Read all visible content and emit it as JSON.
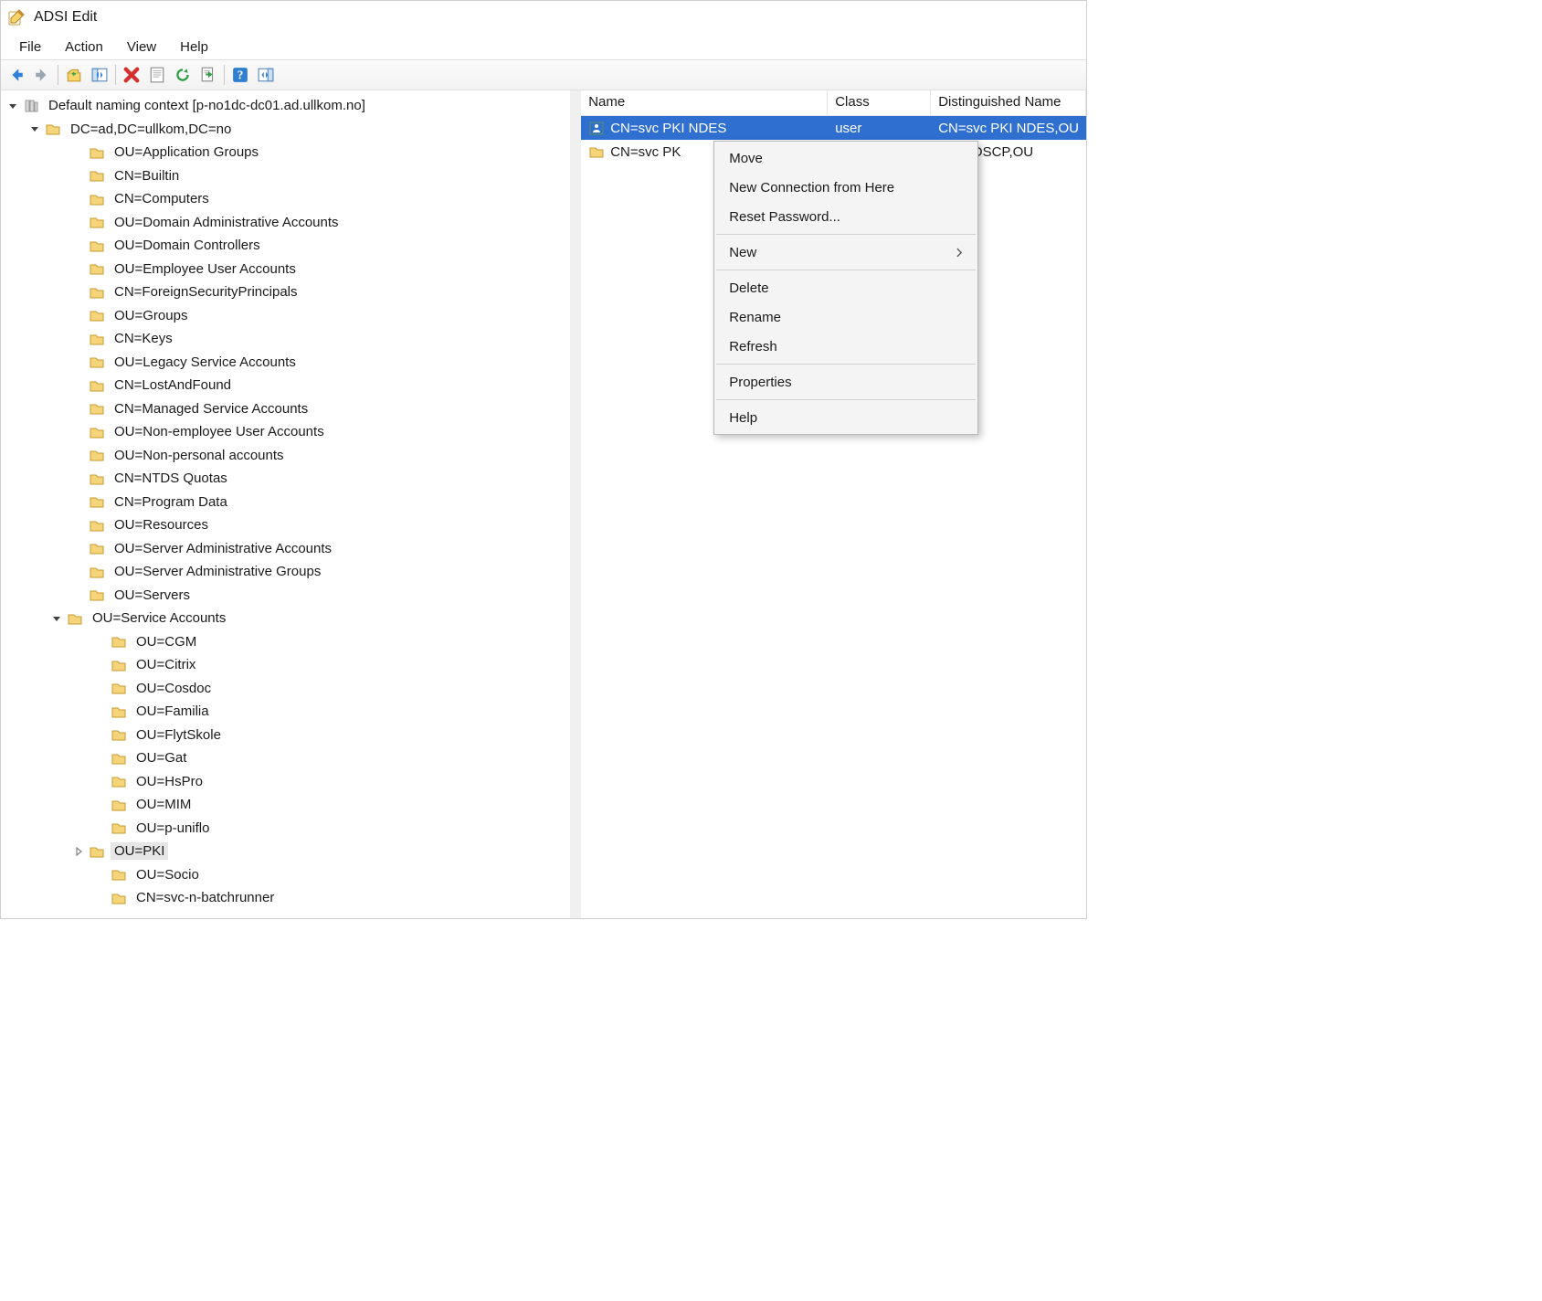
{
  "window_title": "ADSI Edit",
  "menus": {
    "file": "File",
    "action": "Action",
    "view": "View",
    "help": "Help"
  },
  "headers": {
    "name": "Name",
    "class": "Class",
    "dn": "Distinguished Name"
  },
  "tree": {
    "root_label": "Default naming context [p-no1dc-dc01.ad.ullkom.no]",
    "dc_label": "DC=ad,DC=ullkom,DC=no",
    "children": [
      "OU=Application Groups",
      "CN=Builtin",
      "CN=Computers",
      "OU=Domain Administrative Accounts",
      "OU=Domain Controllers",
      "OU=Employee User Accounts",
      "CN=ForeignSecurityPrincipals",
      "OU=Groups",
      "CN=Keys",
      "OU=Legacy Service Accounts",
      "CN=LostAndFound",
      "CN=Managed Service Accounts",
      "OU=Non-employee User Accounts",
      "OU=Non-personal accounts",
      "CN=NTDS Quotas",
      "CN=Program Data",
      "OU=Resources",
      "OU=Server Administrative Accounts",
      "OU=Server Administrative Groups",
      "OU=Servers"
    ],
    "svc_label": "OU=Service Accounts",
    "svc_children": [
      "OU=CGM",
      "OU=Citrix",
      "OU=Cosdoc",
      "OU=Familia",
      "OU=FlytSkole",
      "OU=Gat",
      "OU=HsPro",
      "OU=MIM",
      "OU=p-uniflo"
    ],
    "pki_label": "OU=PKI",
    "after_pki": [
      "OU=Socio",
      "CN=svc-n-batchrunner"
    ]
  },
  "list": {
    "rows": [
      {
        "name": "CN=svc PKI NDES",
        "class": "user",
        "dn": "CN=svc PKI NDES,OU"
      },
      {
        "name": "CN=svc PK",
        "class": "",
        "dn": ": PKI OSCP,OU"
      }
    ]
  },
  "context_menu": {
    "move": "Move",
    "newconn": "New Connection from Here",
    "resetpw": "Reset Password...",
    "new": "New",
    "delete": "Delete",
    "rename": "Rename",
    "refresh": "Refresh",
    "properties": "Properties",
    "help": "Help"
  }
}
